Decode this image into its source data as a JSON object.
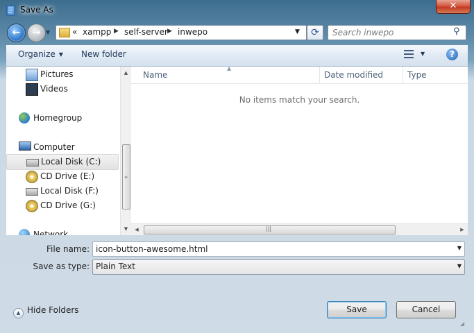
{
  "window": {
    "title": "Save As",
    "close_glyph": "✕"
  },
  "navigation": {
    "back_icon": "back-arrow-icon",
    "forward_icon": "forward-arrow-icon",
    "breadcrumb_prefix": "«",
    "breadcrumb": [
      "xampp",
      "self-server",
      "inwepo"
    ],
    "search_placeholder": "Search inwepo"
  },
  "toolbar": {
    "organize_label": "Organize",
    "new_folder_label": "New folder"
  },
  "sidebar": {
    "items": [
      {
        "label": "Pictures",
        "icon": "pictures-icon"
      },
      {
        "label": "Videos",
        "icon": "videos-icon"
      },
      {
        "label": "Homegroup",
        "icon": "homegroup-icon"
      },
      {
        "label": "Computer",
        "icon": "computer-icon"
      },
      {
        "label": "Local Disk (C:)",
        "icon": "disk-icon",
        "selected": true
      },
      {
        "label": "CD Drive (E:)",
        "icon": "cd-drive-icon"
      },
      {
        "label": "Local Disk (F:)",
        "icon": "disk-icon"
      },
      {
        "label": "CD Drive (G:)",
        "icon": "cd-drive-icon"
      },
      {
        "label": "Network",
        "icon": "network-icon"
      }
    ]
  },
  "files": {
    "columns": [
      "Name",
      "Date modified",
      "Type"
    ],
    "empty_message": "No items match your search."
  },
  "form": {
    "file_name_label": "File name:",
    "file_name_value": "icon-button-awesome.html",
    "save_type_label": "Save as type:",
    "save_type_value": "Plain Text"
  },
  "footer": {
    "hide_folders_label": "Hide Folders",
    "save_label": "Save",
    "cancel_label": "Cancel"
  },
  "colors": {
    "accent": "#3c7fb1",
    "close_button": "#c23a22",
    "window_frame": "#3d6d8e"
  }
}
